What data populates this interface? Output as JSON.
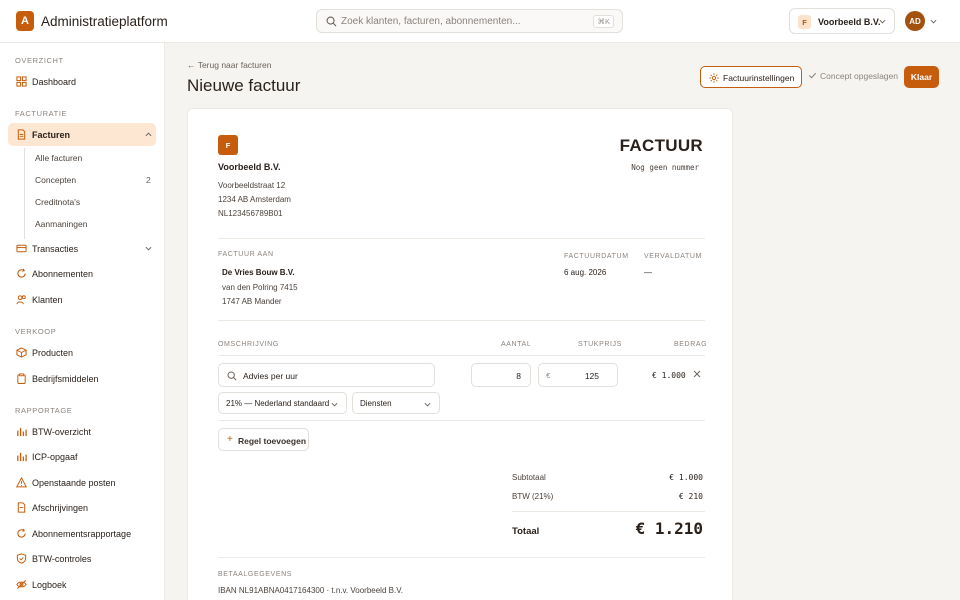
{
  "app": {
    "logo_letter": "A",
    "title": "Administratieplatform"
  },
  "search": {
    "placeholder": "Zoek klanten, facturen, abonnementen...",
    "shortcut": "⌘K"
  },
  "org": {
    "badge": "F",
    "name": "Voorbeeld B.V."
  },
  "user": {
    "initials": "AD"
  },
  "sidebar": {
    "sections": [
      {
        "label": "OVERZICHT"
      },
      {
        "label": "FACTURATIE"
      },
      {
        "label": "VERKOOP"
      },
      {
        "label": "RAPPORTAGE"
      }
    ],
    "items": [
      {
        "label": "Dashboard",
        "icon": "grid-icon"
      },
      {
        "label": "Facturen",
        "icon": "file-icon",
        "active": true
      },
      {
        "label": "Transacties",
        "icon": "card-icon"
      },
      {
        "label": "Abonnementen",
        "icon": "refresh-icon"
      },
      {
        "label": "Klanten",
        "icon": "users-icon"
      },
      {
        "label": "Producten",
        "icon": "box-icon"
      },
      {
        "label": "Bedrijfsmiddelen",
        "icon": "clipboard-icon"
      },
      {
        "label": "BTW-overzicht",
        "icon": "bar-chart-icon"
      },
      {
        "label": "ICP-opgaaf",
        "icon": "bar-chart-icon"
      },
      {
        "label": "Openstaande posten",
        "icon": "warning-icon"
      },
      {
        "label": "Afschrijvingen",
        "icon": "document-icon"
      },
      {
        "label": "Abonnementsrapportage",
        "icon": "refresh-icon"
      },
      {
        "label": "BTW-controles",
        "icon": "shield-icon"
      },
      {
        "label": "Logboek",
        "icon": "eye-off-icon"
      }
    ],
    "subitems": [
      {
        "label": "Alle facturen"
      },
      {
        "label": "Concepten",
        "count": "2"
      },
      {
        "label": "Creditnota's"
      },
      {
        "label": "Aanmaningen"
      }
    ]
  },
  "header": {
    "back": "← Terug naar facturen",
    "title": "Nieuwe factuur",
    "settings_label": "Factuurinstellingen",
    "saved_label": "Concept opgeslagen",
    "done_label": "Klaar"
  },
  "invoice": {
    "logo_letter": "F",
    "company": "Voorbeeld B.V.",
    "address": [
      "Voorbeeldstraat 12",
      "1234 AB Amsterdam",
      "NL123456789B01"
    ],
    "doc_title": "FACTUUR",
    "number": "Nog geen nummer",
    "bill_to_label": "FACTUUR AAN",
    "customer": "De Vries Bouw B.V.",
    "customer_address": [
      "van den Polring 7415",
      "1747 AB Mander"
    ],
    "date_label": "FACTUURDATUM",
    "date": "6 aug. 2026",
    "due_label": "VERVALDATUM",
    "due": "—",
    "columns": {
      "description": "OMSCHRIJVING",
      "qty": "AANTAL",
      "price": "STUKPRIJS",
      "amount": "BEDRAG"
    },
    "line": {
      "description": "Advies per uur",
      "qty": "8",
      "currency": "€",
      "price": "125",
      "amount": "€ 1.000",
      "vat": "21% — Nederland standaard",
      "category": "Diensten"
    },
    "add_line": "Regel toevoegen",
    "subtotal_label": "Subtotaal",
    "subtotal": "€ 1.000",
    "vat_label": "BTW (21%)",
    "vat": "€ 210",
    "total_label": "Totaal",
    "total": "€ 1.210",
    "payment_label": "BETAALGEGEVENS",
    "payment": "IBAN NL91ABNA0417164300 · t.n.v. Voorbeeld B.V."
  },
  "colors": {
    "accent": "#c65d0d",
    "accent_soft": "#fde6d2"
  }
}
